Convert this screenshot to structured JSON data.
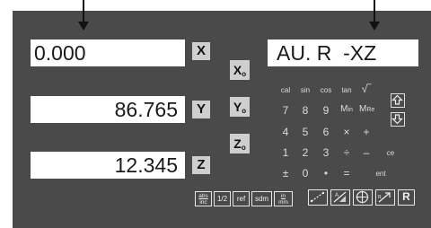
{
  "displays": {
    "x": "0.000",
    "y": "86.765",
    "z": "12.345",
    "message": "AU. R  -XZ"
  },
  "axes": {
    "x_label": "X",
    "y_label": "Y",
    "z_label": "Z"
  },
  "zero_keys": [
    {
      "label": "X",
      "sub": "o"
    },
    {
      "label": "Y",
      "sub": "o"
    },
    {
      "label": "Z",
      "sub": "o"
    }
  ],
  "keypad": {
    "functions": [
      "cal",
      "sin",
      "cos",
      "tan",
      "√‾"
    ],
    "row1": [
      "7",
      "8",
      "9"
    ],
    "row2": [
      "4",
      "5",
      "6",
      "×",
      "+"
    ],
    "row3": [
      "1",
      "2",
      "3",
      "÷",
      "–",
      "ce"
    ],
    "row4": [
      "±",
      "0",
      "•",
      "=",
      "ent"
    ],
    "mem_in": "M",
    "mem_in_sub": "in",
    "mem_recall": "M",
    "mem_recall_sub": "Re"
  },
  "soft_keys": {
    "abs_top": "abs",
    "abs_bottom": "inc",
    "half": "1/2",
    "ref": "ref",
    "sdm": "sdm",
    "in_top": "in",
    "in_bottom": "mm",
    "r": "R"
  },
  "colors": {
    "panel": "#4a4a4a",
    "display_bg": "#ffffff",
    "key_bg": "#cfcfcf"
  }
}
